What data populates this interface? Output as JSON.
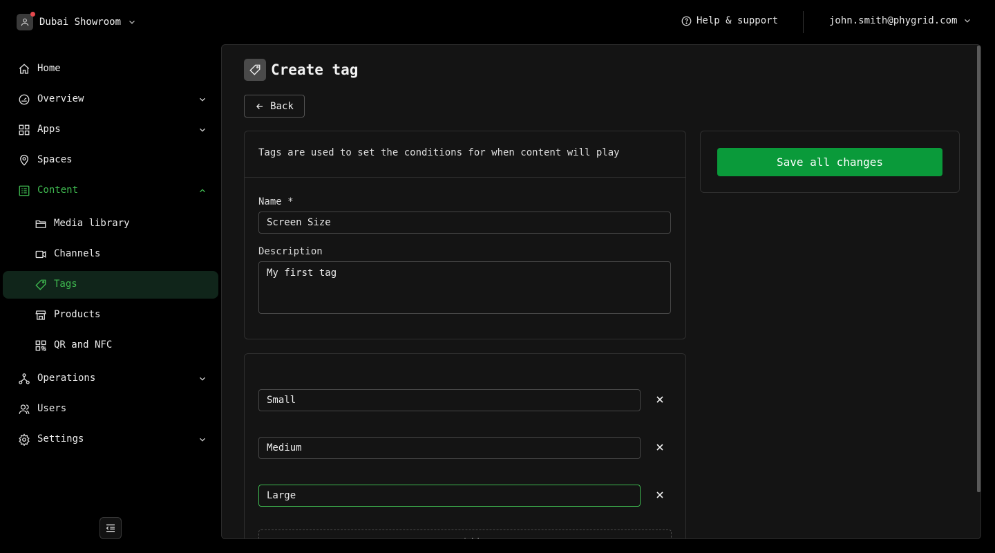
{
  "topbar": {
    "workspace_name": "Dubai Showroom",
    "help_label": "Help & support",
    "user_email": "john.smith@phygrid.com"
  },
  "sidebar": {
    "items": [
      {
        "label": "Home",
        "icon": "home-icon"
      },
      {
        "label": "Overview",
        "icon": "gauge-icon",
        "expandable": true
      },
      {
        "label": "Apps",
        "icon": "grid-icon",
        "expandable": true
      },
      {
        "label": "Spaces",
        "icon": "map-pin-icon"
      },
      {
        "label": "Content",
        "icon": "list-icon",
        "expanded": true
      },
      {
        "label": "Media library",
        "icon": "folder-icon"
      },
      {
        "label": "Channels",
        "icon": "video-icon"
      },
      {
        "label": "Tags",
        "icon": "tag-icon",
        "active": true
      },
      {
        "label": "Products",
        "icon": "store-icon"
      },
      {
        "label": "QR and NFC",
        "icon": "qr-icon"
      },
      {
        "label": "Operations",
        "icon": "network-icon",
        "expandable": true
      },
      {
        "label": "Users",
        "icon": "users-icon"
      },
      {
        "label": "Settings",
        "icon": "gear-icon",
        "expandable": true
      }
    ]
  },
  "page": {
    "title": "Create tag",
    "back_label": "Back"
  },
  "form": {
    "intro": "Tags are used to set the conditions for when content will play",
    "name_label": "Name *",
    "name_value": "Screen Size",
    "description_label": "Description",
    "description_value": "My first tag",
    "values": [
      "Small",
      "Medium",
      "Large"
    ],
    "add_label": "+ Add"
  },
  "actions": {
    "save_label": "Save all changes"
  },
  "colors": {
    "accent": "#3fb950",
    "save_button": "#0a9a3a",
    "active_nav_bg": "#10251a",
    "notification_dot": "#e5484d"
  }
}
